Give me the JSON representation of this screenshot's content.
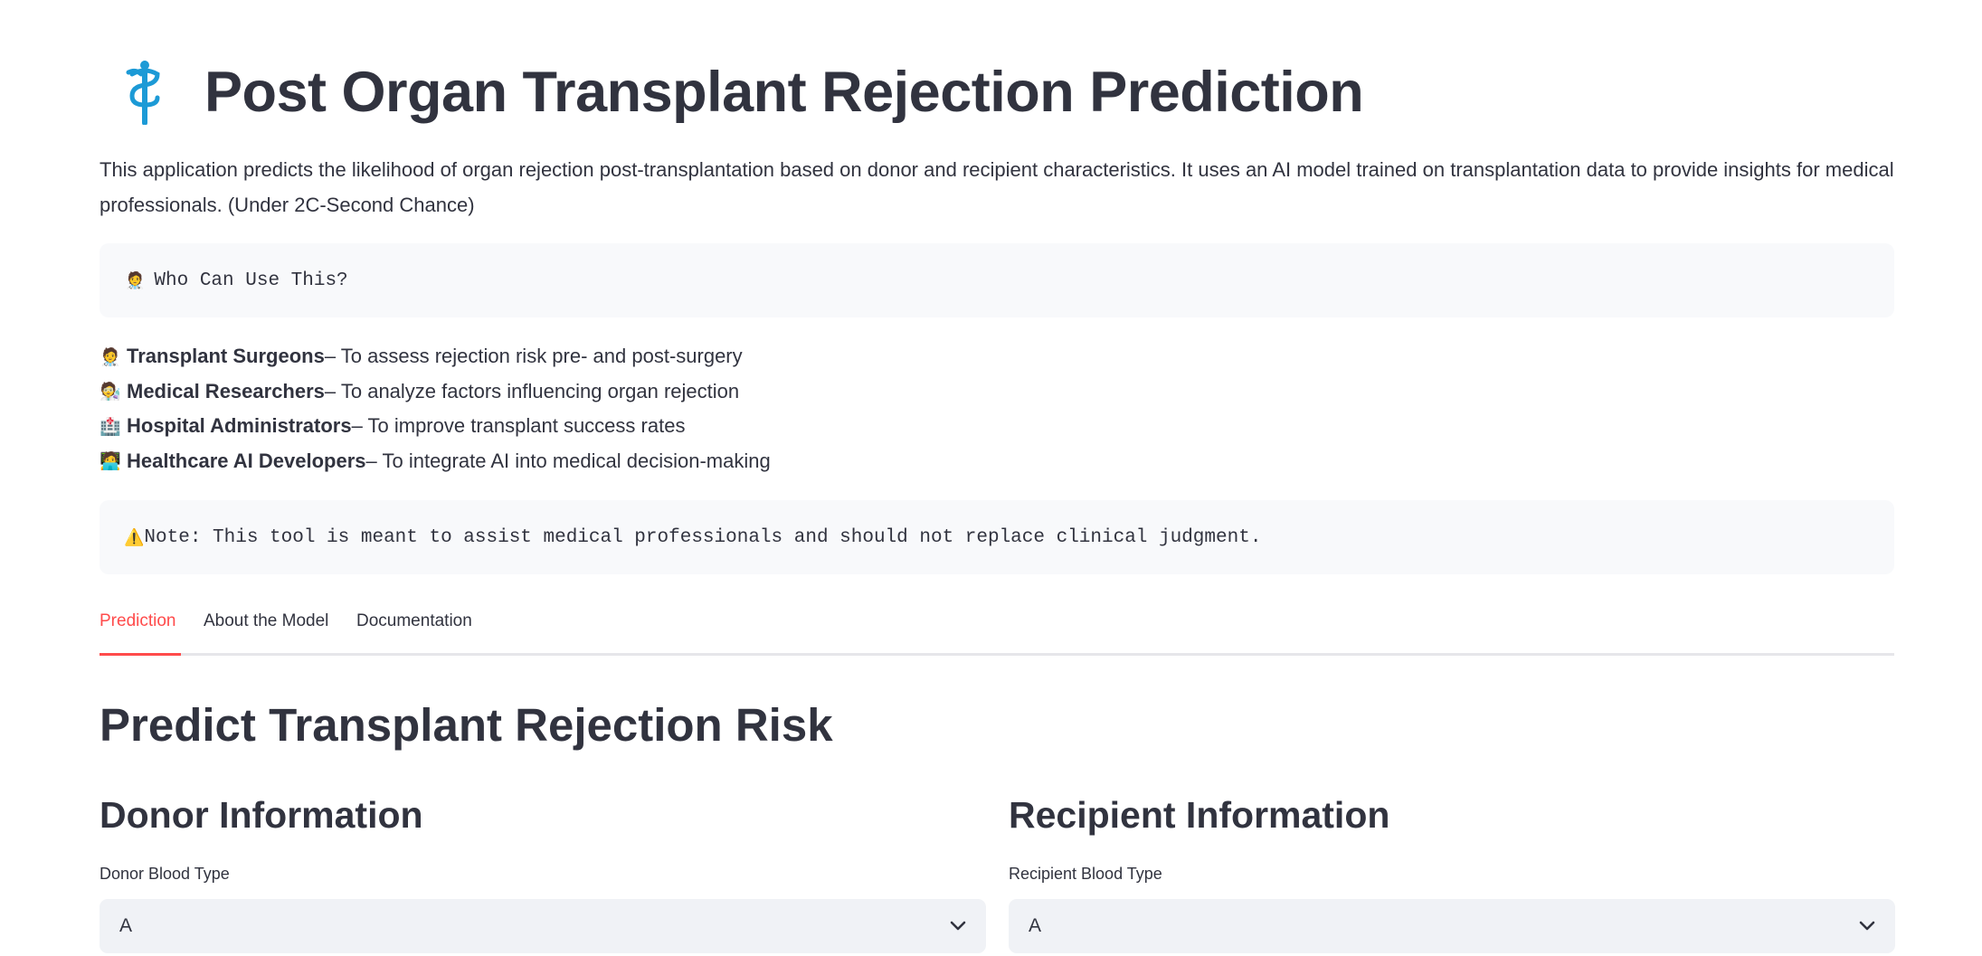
{
  "header": {
    "icon": "staff-of-aesculapius-icon",
    "title": "Post Organ Transplant Rejection Prediction"
  },
  "intro": "This application predicts the likelihood of organ rejection post-transplantation based on donor and recipient characteristics. It uses an AI model trained on transplantation data to provide insights for medical professionals. (Under 2C-Second Chance)",
  "who_box": {
    "emoji": "🧑‍⚕️",
    "text": "Who Can Use This?"
  },
  "roles": [
    {
      "emoji": "🧑‍⚕️",
      "name": "Transplant Surgeons",
      "desc": " – To assess rejection risk pre- and post-surgery"
    },
    {
      "emoji": "🧑‍🔬",
      "name": "Medical Researchers",
      "desc": " – To analyze factors influencing organ rejection"
    },
    {
      "emoji": "🏥",
      "name": "Hospital Administrators",
      "desc": " – To improve transplant success rates"
    },
    {
      "emoji": "🧑‍💻",
      "name": "Healthcare AI Developers",
      "desc": " – To integrate AI into medical decision-making"
    }
  ],
  "note_box": {
    "emoji": "⚠️",
    "text": "Note: This tool is meant to assist medical professionals and should not replace clinical judgment."
  },
  "tabs": [
    {
      "label": "Prediction",
      "active": true
    },
    {
      "label": "About the Model",
      "active": false
    },
    {
      "label": "Documentation",
      "active": false
    }
  ],
  "prediction": {
    "title": "Predict Transplant Rejection Risk",
    "donor": {
      "heading": "Donor Information",
      "blood_type_label": "Donor Blood Type",
      "blood_type_value": "A"
    },
    "recipient": {
      "heading": "Recipient Information",
      "blood_type_label": "Recipient Blood Type",
      "blood_type_value": "A"
    }
  },
  "colors": {
    "accent": "#ff4b4b",
    "text": "#31333f",
    "code_bg": "#f8f9fb",
    "select_bg": "#f0f2f6",
    "icon_blue": "#1c9ad6"
  }
}
